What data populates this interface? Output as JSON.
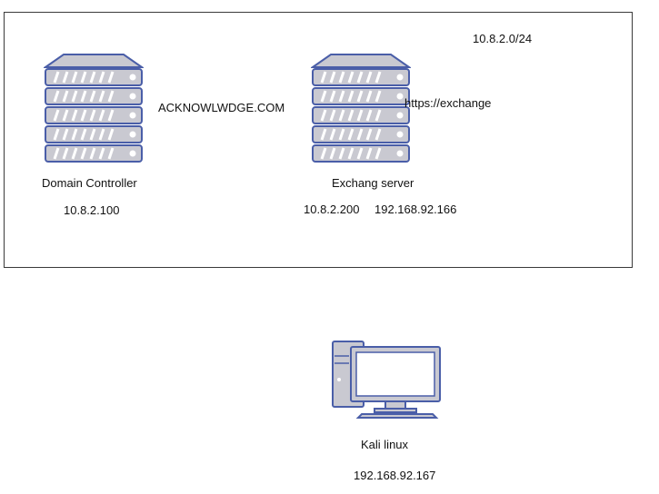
{
  "network": {
    "subnet": "10.8.2.0/24",
    "domain_name": "ACKNOWLWDGE.COM"
  },
  "nodes": {
    "domain_controller": {
      "name": "Domain Controller",
      "ip": "10.8.2.100",
      "icon": "server-icon"
    },
    "exchange_server": {
      "name": "Exchang server",
      "ip_internal": "10.8.2.200",
      "ip_external": "192.168.92.166",
      "url": "https://exchange",
      "icon": "server-icon"
    },
    "kali": {
      "name": "Kali linux",
      "ip": "192.168.92.167",
      "icon": "desktop-computer-icon"
    }
  },
  "colors": {
    "icon_fill": "#c9c9d1",
    "icon_stroke": "#4a5ea8",
    "frame_border": "#3a3a3a"
  }
}
